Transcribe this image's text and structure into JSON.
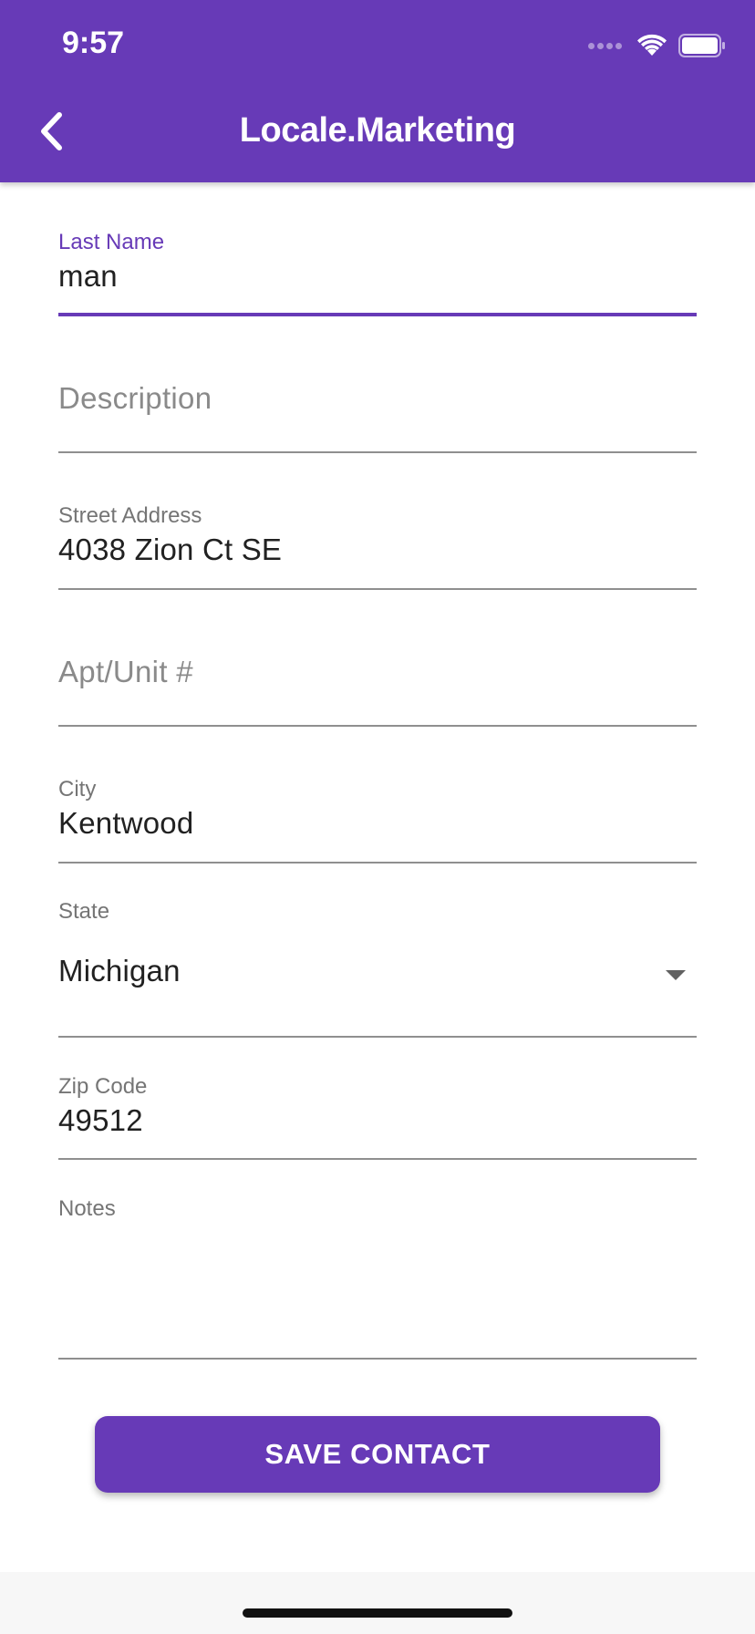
{
  "status_bar": {
    "time": "9:57",
    "icons": [
      "signal-icon",
      "wifi-icon",
      "battery-icon"
    ]
  },
  "app_bar": {
    "title": "Locale.Marketing",
    "back_icon": "chevron-left-icon"
  },
  "form": {
    "last_name": {
      "label": "Last Name",
      "value": "man",
      "focused": true
    },
    "description": {
      "placeholder": "Description",
      "value": ""
    },
    "street_address": {
      "label": "Street Address",
      "value": "4038 Zion Ct SE"
    },
    "apt_unit": {
      "placeholder": "Apt/Unit #",
      "value": ""
    },
    "city": {
      "label": "City",
      "value": "Kentwood"
    },
    "state": {
      "label": "State",
      "selected": "Michigan",
      "icon": "dropdown-arrow-icon"
    },
    "zip_code": {
      "label": "Zip Code",
      "value": "49512"
    },
    "notes": {
      "label": "Notes",
      "value": ""
    }
  },
  "actions": {
    "save_label": "SAVE CONTACT"
  },
  "colors": {
    "primary": "#673AB7",
    "text": "#212121",
    "label": "#757575",
    "underline": "#8f8f8f"
  }
}
